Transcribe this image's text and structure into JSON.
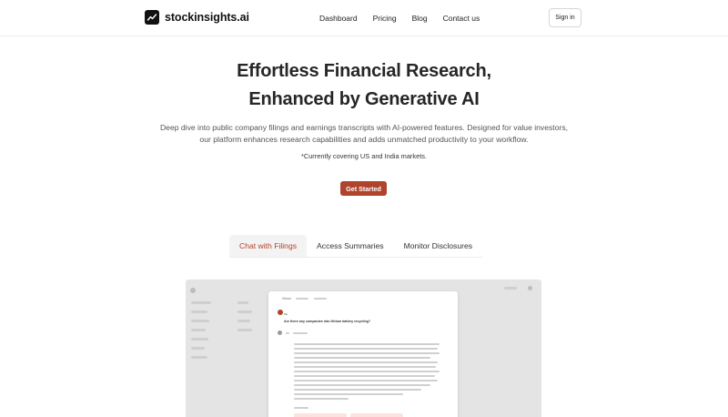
{
  "nav": {
    "brand": "stockinsights.ai",
    "links": [
      "Dashboard",
      "Pricing",
      "Blog",
      "Contact us"
    ],
    "signin": "Sign in"
  },
  "hero": {
    "title_line1": "Effortless Financial Research,",
    "title_line2": "Enhanced by Generative AI",
    "subtitle": "Deep dive into public company filings and earnings transcripts with AI-powered features. Designed for value investors, our platform enhances research capabilities and adds unmatched productivity to your workflow.",
    "note": "*Currently covering US and India markets.",
    "cta": "Get Started"
  },
  "tabs": [
    {
      "label": "Chat with Filings",
      "active": true
    },
    {
      "label": "Access Summaries",
      "active": false
    },
    {
      "label": "Monitor Disclosures",
      "active": false
    }
  ],
  "preview": {
    "user": "Me",
    "question": "Are there any companies into lithium battery recycling?"
  },
  "colors": {
    "accent": "#b0432c",
    "text": "#262626",
    "muted": "#555555"
  }
}
